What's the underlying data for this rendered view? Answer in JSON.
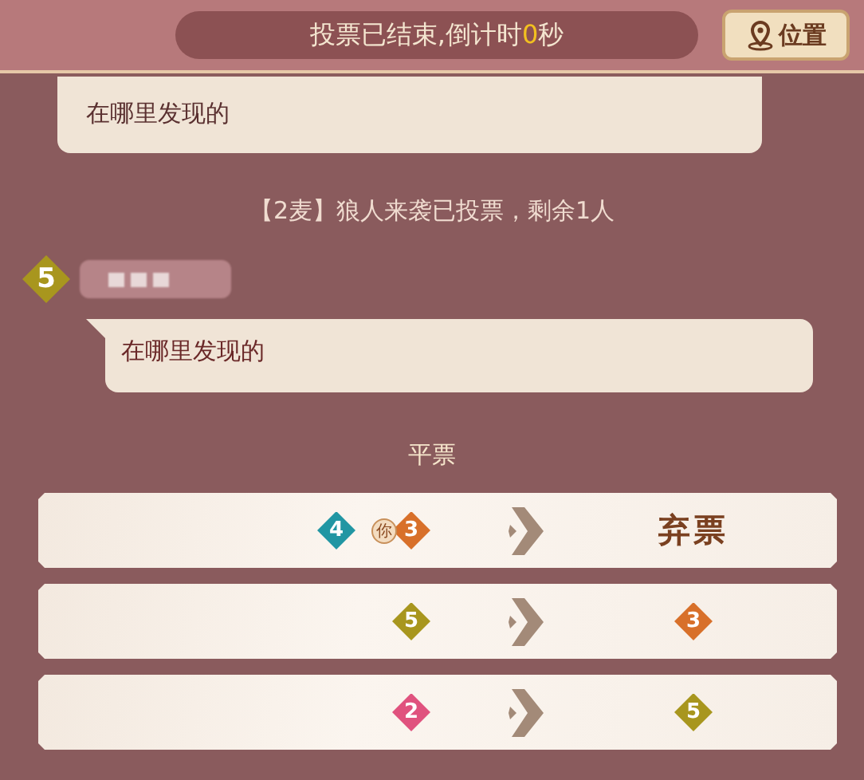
{
  "countdown": {
    "before": "投票已结束,倒计时",
    "seconds": "0",
    "after": "秒"
  },
  "location_button": {
    "label": "位置"
  },
  "messages": [
    {
      "kind": "bubble",
      "text": "在哪里发现的"
    },
    {
      "kind": "system",
      "text": "【2麦】狼人来袭已投票，剩余1人"
    },
    {
      "kind": "player",
      "seat": "5",
      "color": "#a8961e",
      "text": "在哪里发现的"
    }
  ],
  "result": {
    "title": "平票"
  },
  "votes": [
    {
      "voters": [
        {
          "seat": "4",
          "color": "#2196a3",
          "you": false
        },
        {
          "seat": "3",
          "color": "#d8702a",
          "you": true,
          "you_label": "你"
        }
      ],
      "target": {
        "kind": "abstain",
        "label": "弃票"
      }
    },
    {
      "voters": [
        {
          "seat": "5",
          "color": "#a8961e",
          "you": false
        }
      ],
      "target": {
        "kind": "player",
        "seat": "3",
        "color": "#d8702a"
      }
    },
    {
      "voters": [
        {
          "seat": "2",
          "color": "#e0527e",
          "you": false
        }
      ],
      "target": {
        "kind": "player",
        "seat": "5",
        "color": "#a8961e"
      }
    }
  ]
}
